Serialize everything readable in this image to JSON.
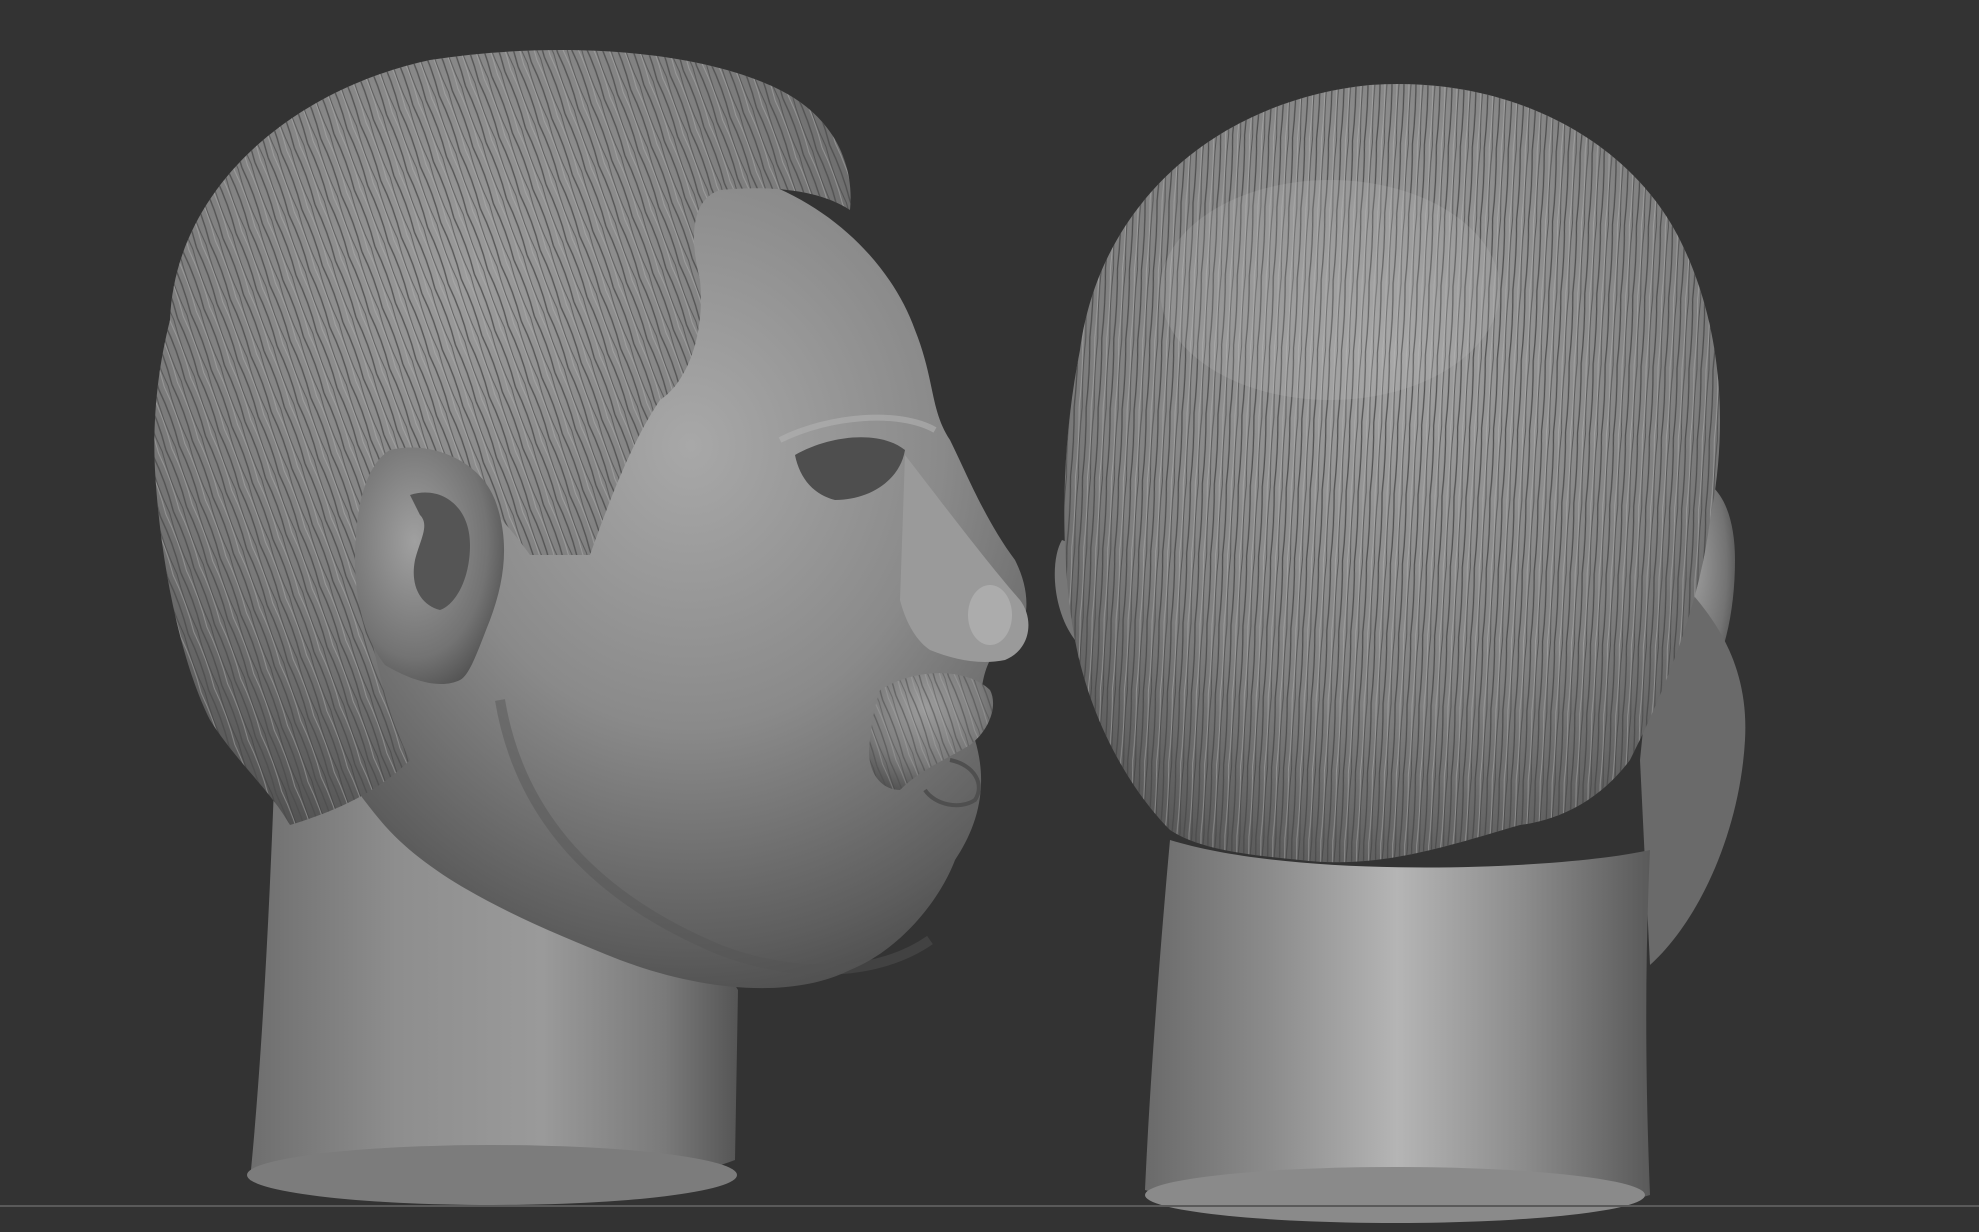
{
  "viewport": {
    "background_color": "#333333",
    "material_color": "#8c8c8c"
  },
  "models": [
    {
      "view": "side-profile",
      "subject": "head-sculpt"
    },
    {
      "view": "back",
      "subject": "head-sculpt"
    }
  ]
}
